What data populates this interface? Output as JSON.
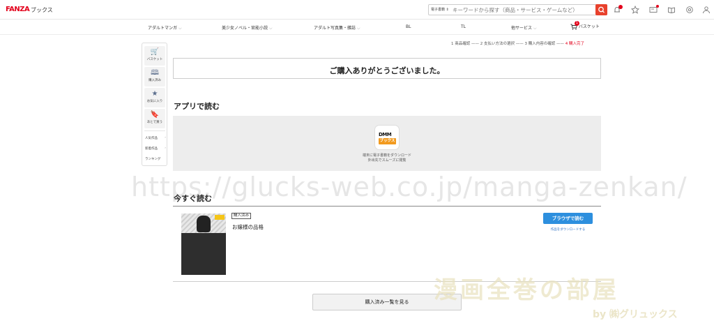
{
  "header": {
    "logo": "FANZA",
    "logo_sub": "ブックス",
    "search_category": "電子書籍 ⇕",
    "search_placeholder": "キーワードから探す（商品・サービス・ゲームなど）",
    "notification_count": "1"
  },
  "nav": {
    "items": [
      {
        "label": "アダルトマンガ",
        "chevron": "⌵"
      },
      {
        "label": "美少女ノベル・官能小説",
        "chevron": "⌵"
      },
      {
        "label": "アダルト写真集・雑誌",
        "chevron": "⌵"
      },
      {
        "label": "BL",
        "chevron": ""
      },
      {
        "label": "TL",
        "chevron": ""
      },
      {
        "label": "他サービス",
        "chevron": "⌵"
      }
    ],
    "basket_label": "バスケット",
    "basket_count": "1"
  },
  "sidebar": {
    "buttons": [
      {
        "label": "バスケット",
        "icon": "🛒"
      },
      {
        "label": "購入済み",
        "icon": "🕮"
      },
      {
        "label": "お気に入り",
        "icon": "★"
      },
      {
        "label": "あとで買う",
        "icon": "🔖"
      }
    ],
    "links": [
      {
        "label": "人気作品",
        "chevron": "›"
      },
      {
        "label": "新着作品",
        "chevron": "›"
      },
      {
        "label": "ランキング",
        "chevron": ""
      }
    ]
  },
  "steps": {
    "step1": "1 商品確認",
    "step2": "2 支払い方法の選択",
    "step3": "3 購入内容の確認",
    "step4": "4 購入完了",
    "separator": " —— "
  },
  "thanks": "ご購入ありがとうございました。",
  "app_section": {
    "title": "アプリで読む",
    "icon_top": "DMM",
    "icon_bottom": "ブックス",
    "desc1": "端末に電子書籍をダウンロード",
    "desc2": "外出先でスムーズに閲覧"
  },
  "read_now": {
    "title": "今すぐ読む",
    "badge": "購入済み",
    "item_title": "お嬢様の品格",
    "browser_button": "ブラウザで読む",
    "download_link": "作品をダウンロードする"
  },
  "view_all_button": "購入済み一覧を見る",
  "watermark": "https://glucks-web.co.jp/manga-zenkan/",
  "stamp": {
    "big": "漫画全巻の部屋",
    "by": "by ㈱グリュックス"
  }
}
